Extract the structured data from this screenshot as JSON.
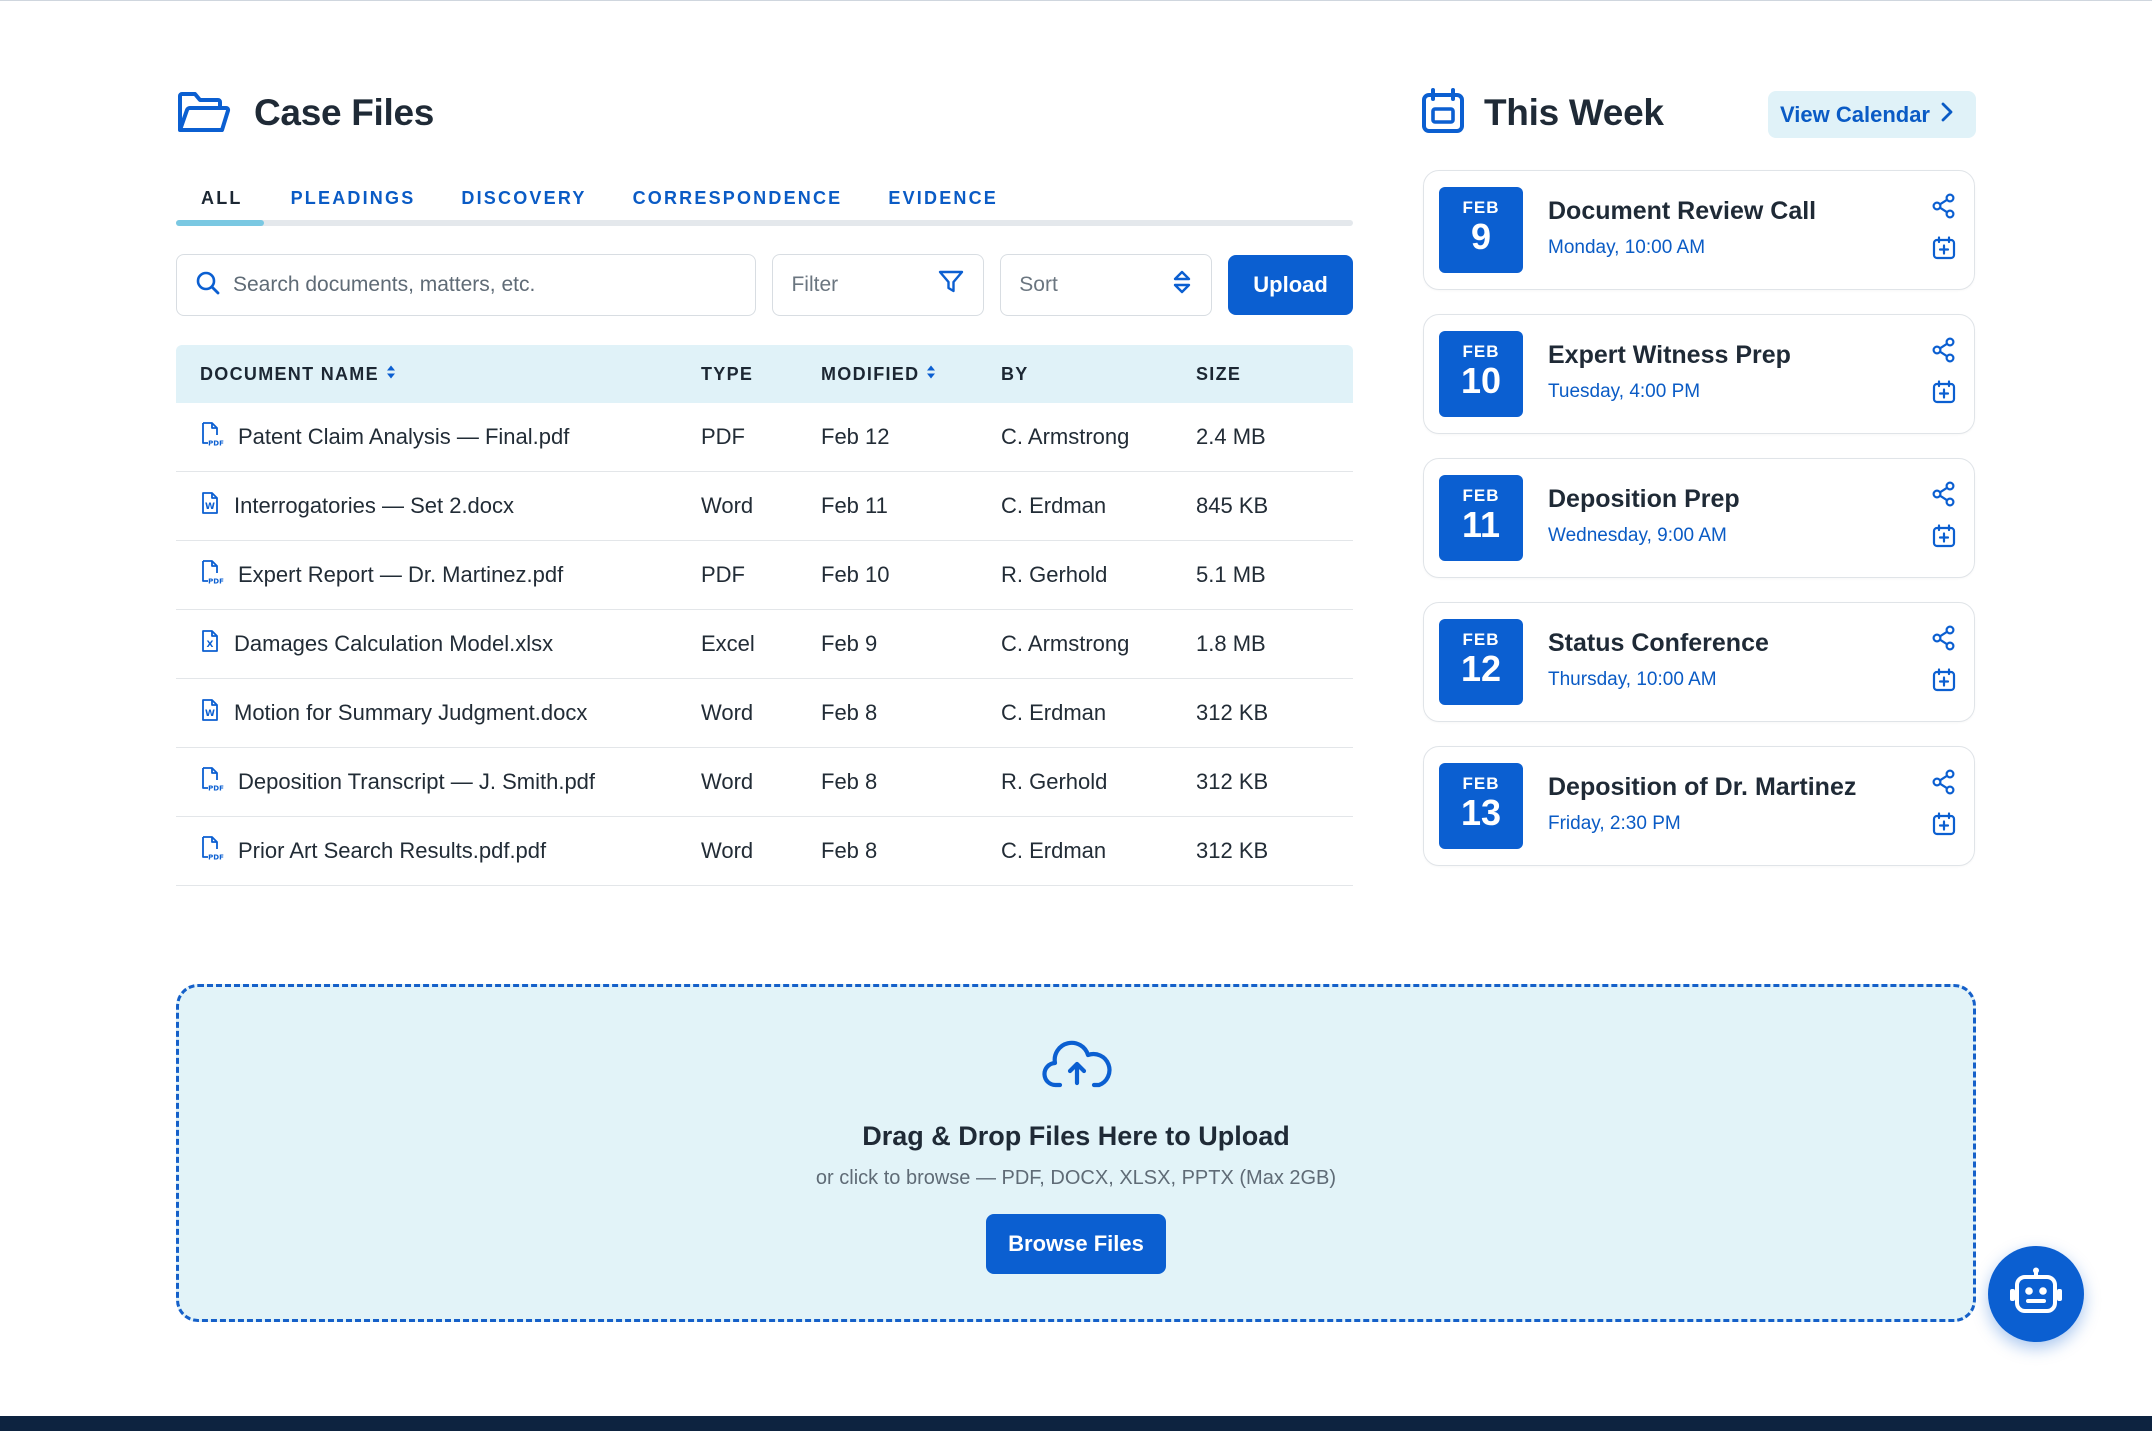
{
  "case_files": {
    "title": "Case Files",
    "tabs": [
      {
        "label": "ALL"
      },
      {
        "label": "PLEADINGS"
      },
      {
        "label": "DISCOVERY"
      },
      {
        "label": "CORRESPONDENCE"
      },
      {
        "label": "EVIDENCE"
      }
    ],
    "active_tab": "ALL",
    "search": {
      "placeholder": "Search documents, matters, etc."
    },
    "filter": {
      "placeholder": "Filter"
    },
    "sort": {
      "placeholder": "Sort"
    },
    "upload_label": "Upload",
    "table": {
      "headers": {
        "name": "DOCUMENT NAME",
        "type": "TYPE",
        "modified": "MODIFIED",
        "by": "BY",
        "size": "SIZE"
      },
      "rows": [
        {
          "icon": "pdf-file-icon",
          "name": "Patent Claim Analysis — Final.pdf",
          "type": "PDF",
          "modified": "Feb 12",
          "by": "C. Armstrong",
          "size": "2.4 MB"
        },
        {
          "icon": "word-file-icon",
          "name": "Interrogatories — Set 2.docx",
          "type": "Word",
          "modified": "Feb 11",
          "by": "C. Erdman",
          "size": "845 KB"
        },
        {
          "icon": "pdf-file-icon",
          "name": "Expert Report — Dr. Martinez.pdf",
          "type": "PDF",
          "modified": "Feb 10",
          "by": "R. Gerhold",
          "size": "5.1 MB"
        },
        {
          "icon": "excel-file-icon",
          "name": "Damages Calculation Model.xlsx",
          "type": "Excel",
          "modified": "Feb 9",
          "by": "C. Armstrong",
          "size": "1.8 MB"
        },
        {
          "icon": "word-file-icon",
          "name": "Motion for Summary Judgment.docx",
          "type": "Word",
          "modified": "Feb 8",
          "by": "C. Erdman",
          "size": "312 KB"
        },
        {
          "icon": "pdf-file-icon",
          "name": "Deposition Transcript — J. Smith.pdf",
          "type": "Word",
          "modified": "Feb 8",
          "by": "R. Gerhold",
          "size": "312 KB"
        },
        {
          "icon": "pdf-file-icon",
          "name": "Prior Art Search Results.pdf.pdf",
          "type": "Word",
          "modified": "Feb 8",
          "by": "C. Erdman",
          "size": "312 KB"
        }
      ]
    }
  },
  "this_week": {
    "title": "This Week",
    "view_calendar_label": "View Calendar",
    "events": [
      {
        "month": "FEB",
        "day": "9",
        "title": "Document Review Call",
        "time": "Monday, 10:00 AM"
      },
      {
        "month": "FEB",
        "day": "10",
        "title": "Expert Witness Prep",
        "time": "Tuesday, 4:00 PM"
      },
      {
        "month": "FEB",
        "day": "11",
        "title": "Deposition Prep",
        "time": "Wednesday, 9:00 AM"
      },
      {
        "month": "FEB",
        "day": "12",
        "title": "Status Conference",
        "time": "Thursday, 10:00 AM"
      },
      {
        "month": "FEB",
        "day": "13",
        "title": "Deposition of Dr. Martinez",
        "time": "Friday, 2:30 PM"
      }
    ]
  },
  "dropzone": {
    "title": "Drag & Drop Files Here to Upload",
    "subtitle": "or click to browse — PDF, DOCX, XLSX, PPTX (Max 2GB)",
    "button_label": "Browse Files"
  },
  "colors": {
    "accent": "#0b5fd1",
    "accent_text": "#0a5bc5",
    "header_bg": "#e0f2f8",
    "tab_indicator": "#7ac8e2",
    "footer": "#0d2340"
  },
  "icons": {
    "case_files": "folder-open-icon",
    "this_week": "calendar-icon",
    "search": "search-icon",
    "filter": "filter-icon",
    "sort": "sort-icon",
    "view_calendar": "chevron-right-icon",
    "event_share": "share-icon",
    "event_add": "calendar-plus-icon",
    "dropzone": "cloud-upload-icon",
    "assistant": "robot-icon"
  }
}
